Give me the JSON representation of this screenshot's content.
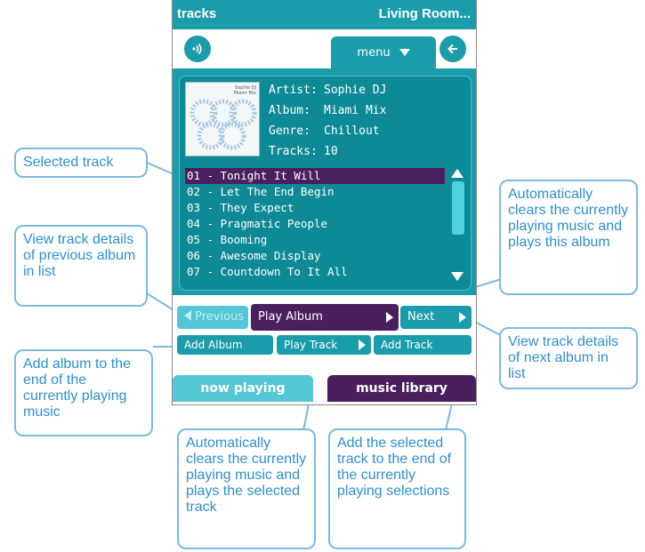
{
  "app": {
    "title": "tracks",
    "device": "Living Room...",
    "menu_label": "menu",
    "speaker_icon": "speaker-icon",
    "back_icon": "back-arrow-icon"
  },
  "album": {
    "artist_label": "Artist:",
    "artist": "Sophie DJ",
    "album_label": "Album:",
    "album": "Miami Mix",
    "genre_label": "Genre:",
    "genre": "Chillout",
    "tracks_label": "Tracks:",
    "tracks": "10",
    "art_caption_1": "Sophie DJ",
    "art_caption_2": "Miami Mix"
  },
  "track_list": [
    "01 - Tonight It Will",
    "02 - Let The End Begin",
    "03 - They Expect",
    "04 - Pragmatic People",
    "05 - Booming",
    "06 - Awesome Display",
    "07 - Countdown To It All"
  ],
  "buttons": {
    "previous": "Previous",
    "play_album": "Play Album",
    "next": "Next",
    "add_album": "Add Album",
    "play_track": "Play Track",
    "add_track": "Add Track"
  },
  "tabs": {
    "now_playing": "now playing",
    "music_library": "music library"
  },
  "callouts": {
    "selected_track": "Selected track",
    "prev_album": "View track details of previous album in list",
    "play_album": "Automatically clears the currently playing music and plays this album",
    "add_album": "Add album to the end of the currently playing music",
    "next_album": "View track details of next album in list",
    "play_track": "Automatically clears the currently playing music and plays the selected track",
    "add_track": "Add the selected track to the end of the currently playing selections"
  },
  "colors": {
    "teal": "#1b9cab",
    "purple": "#4a1f5e",
    "callout_text": "#2d8fd0",
    "callout_border": "#7bbadf"
  }
}
